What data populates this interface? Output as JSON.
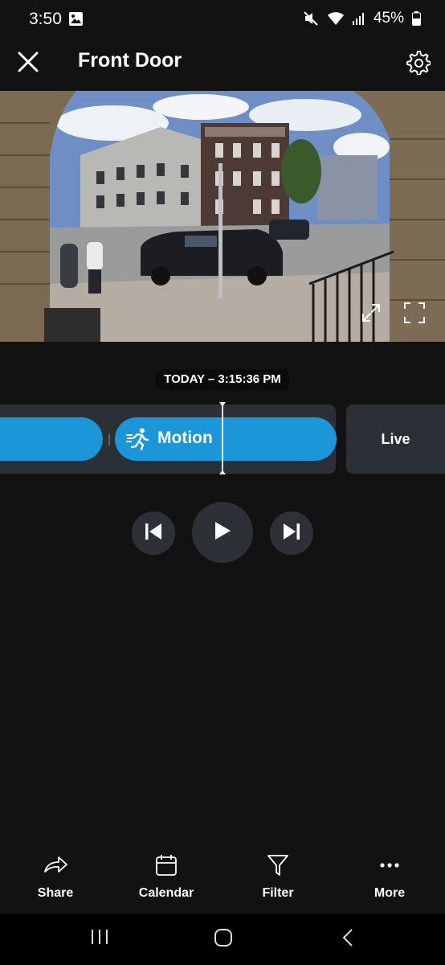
{
  "status_bar": {
    "time": "3:50",
    "battery": "45%",
    "icons": [
      "photo-icon",
      "mute-icon",
      "wifi-icon",
      "signal-icon",
      "battery-icon"
    ]
  },
  "header": {
    "title": "Front Door",
    "icons": [
      "close-icon",
      "gear-icon"
    ]
  },
  "video": {
    "icons": [
      "expand-icon",
      "fullscreen-icon"
    ]
  },
  "timeline": {
    "timestamp": "TODAY – 3:15:36 PM",
    "event_label": "Motion",
    "live_label": "Live",
    "accent_color": "#1a96d9"
  },
  "playback": {
    "icons": [
      "skip-previous-icon",
      "play-icon",
      "skip-next-icon"
    ]
  },
  "bottom_nav": {
    "share": "Share",
    "calendar": "Calendar",
    "filter": "Filter",
    "more": "More"
  },
  "system_nav": {
    "icons": [
      "recents-icon",
      "home-icon",
      "back-icon"
    ]
  }
}
